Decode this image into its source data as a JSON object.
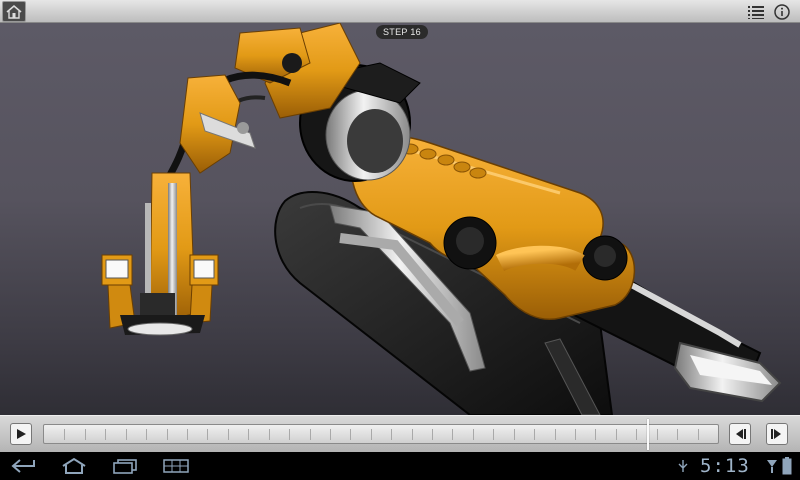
{
  "toolbar": {
    "home_icon": "home-icon",
    "parts_list_icon": "list-icon",
    "info_icon": "info-icon"
  },
  "viewer": {
    "step_label": "STEP 16",
    "model_colors": {
      "body": "#e29a16",
      "chrome": "#c9c9c9",
      "base": "#141414",
      "background": "#56535e"
    }
  },
  "player": {
    "play_icon": "play-icon",
    "prev_icon": "step-back-icon",
    "next_icon": "step-forward-icon",
    "progress": 0.895
  },
  "system_bar": {
    "back_icon": "back-icon",
    "home_icon": "home-icon",
    "recent_apps_icon": "recent-apps-icon",
    "screenshot_icon": "screenshot-icon",
    "time": "5:13"
  }
}
